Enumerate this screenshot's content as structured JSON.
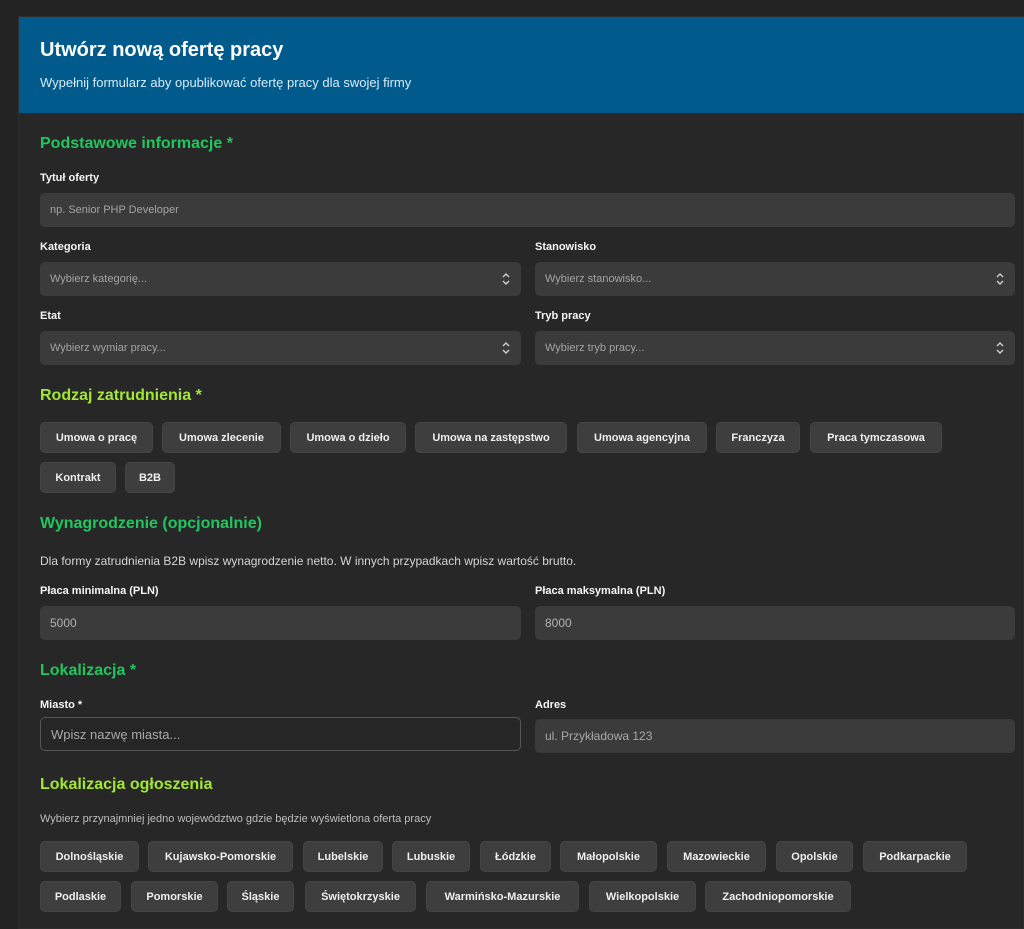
{
  "header": {
    "title": "Utwórz nową ofertę pracy",
    "subtitle": "Wypełnij formularz aby opublikować ofertę pracy dla swojej firmy"
  },
  "basic": {
    "title": "Podstawowe informacje *",
    "job_title_label": "Tytuł oferty",
    "job_title_placeholder": "np. Senior PHP Developer",
    "category_label": "Kategoria",
    "category_value": "Wybierz kategorię...",
    "position_label": "Stanowisko",
    "position_value": "Wybierz stanowisko...",
    "worktime_label": "Etat",
    "worktime_value": "Wybierz wymiar pracy...",
    "workmode_label": "Tryb pracy",
    "workmode_value": "Wybierz tryb pracy..."
  },
  "employment": {
    "title": "Rodzaj zatrudnienia *",
    "types": [
      "Umowa o pracę",
      "Umowa zlecenie",
      "Umowa o dzieło",
      "Umowa na zastępstwo",
      "Umowa agencyjna",
      "Franczyza",
      "Praca tymczasowa",
      "Kontrakt",
      "B2B"
    ]
  },
  "salary": {
    "title": "Wynagrodzenie (opcjonalnie)",
    "note": "Dla formy zatrudnienia B2B wpisz wynagrodzenie netto. W innych przypadkach wpisz wartość brutto.",
    "min_label": "Płaca minimalna (PLN)",
    "min_placeholder": "5000",
    "max_label": "Płaca maksymalna (PLN)",
    "max_placeholder": "8000"
  },
  "location": {
    "title": "Lokalizacja *",
    "city_label": "Miasto *",
    "city_placeholder": "Wpisz nazwę miasta...",
    "address_label": "Adres",
    "address_placeholder": "ul. Przykładowa 123"
  },
  "ad_location": {
    "title": "Lokalizacja ogłoszenia",
    "note": "Wybierz przynajmniej jedno województwo gdzie będzie wyświetlona oferta pracy",
    "voivodeships": [
      "Dolnośląskie",
      "Kujawsko-Pomorskie",
      "Lubelskie",
      "Lubuskie",
      "Łódzkie",
      "Małopolskie",
      "Mazowieckie",
      "Opolskie",
      "Podkarpackie",
      "Podlaskie",
      "Pomorskie",
      "Śląskie",
      "Świętokrzyskie",
      "Warmińsko-Mazurskie",
      "Wielkopolskie",
      "Zachodniopomorskie"
    ]
  },
  "colors": {
    "header_bg": "#005a8c",
    "section_green": "#22c55e",
    "section_lime": "#a3e635",
    "page_bg": "#232323"
  }
}
